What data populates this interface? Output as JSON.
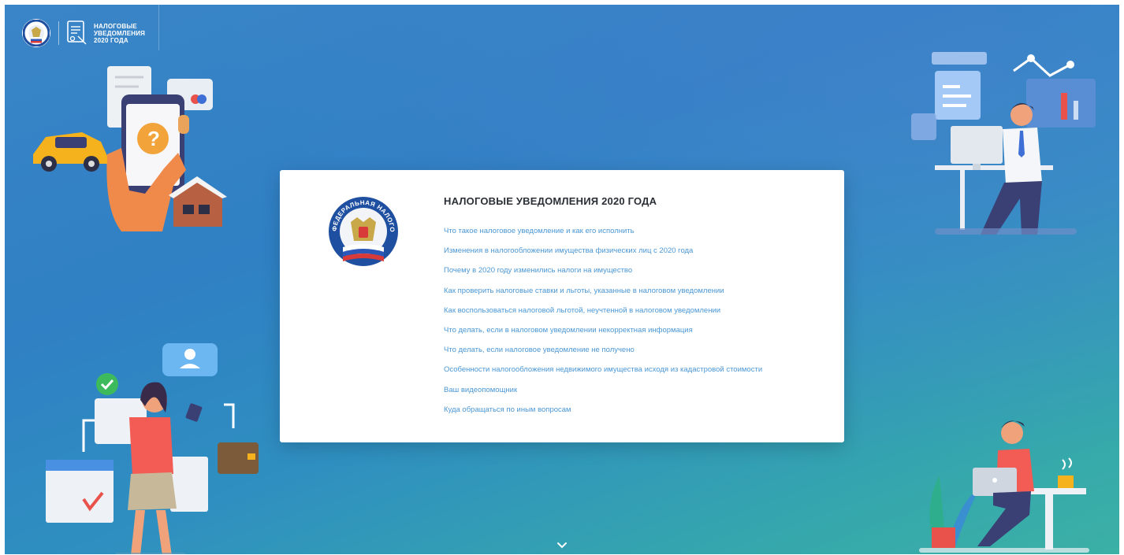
{
  "header": {
    "brand_text": "НАЛОГОВЫЕ УВЕДОМЛЕНИЯ 2020 ГОДА"
  },
  "card": {
    "title": "НАЛОГОВЫЕ УВЕДОМЛЕНИЯ 2020 ГОДА",
    "emblem_text": "ФЕДЕРАЛЬНАЯ НАЛОГОВАЯ СЛУЖБА",
    "links": [
      "Что такое налоговое уведомление и как его исполнить",
      "Изменения в налогообложении имущества физических лиц с 2020 года",
      "Почему в 2020 году изменились налоги на имущество",
      "Как проверить налоговые ставки и льготы, указанные в налоговом уведомлении",
      "Как воспользоваться налоговой льготой, неучтенной в налоговом уведомлении",
      "Что делать, если в налоговом уведомлении некорректная информация",
      "Что делать, если налоговое уведомление не получено",
      "Особенности налогообложения недвижимого имущества исходя из кадастровой стоимости",
      "Ваш видеопомощник",
      "Куда обращаться по иным вопросам"
    ]
  },
  "colors": {
    "bg_top": "#3a85c7",
    "bg_bottom": "#3bb0a5",
    "link": "#4b97d4",
    "title": "#2b2f36",
    "accent_orange": "#f2a33a",
    "accent_red": "#e8524a"
  },
  "icons": {
    "scroll_down": "chevron-down-icon",
    "emblem": "fns-emblem-icon",
    "document": "document-icon"
  }
}
